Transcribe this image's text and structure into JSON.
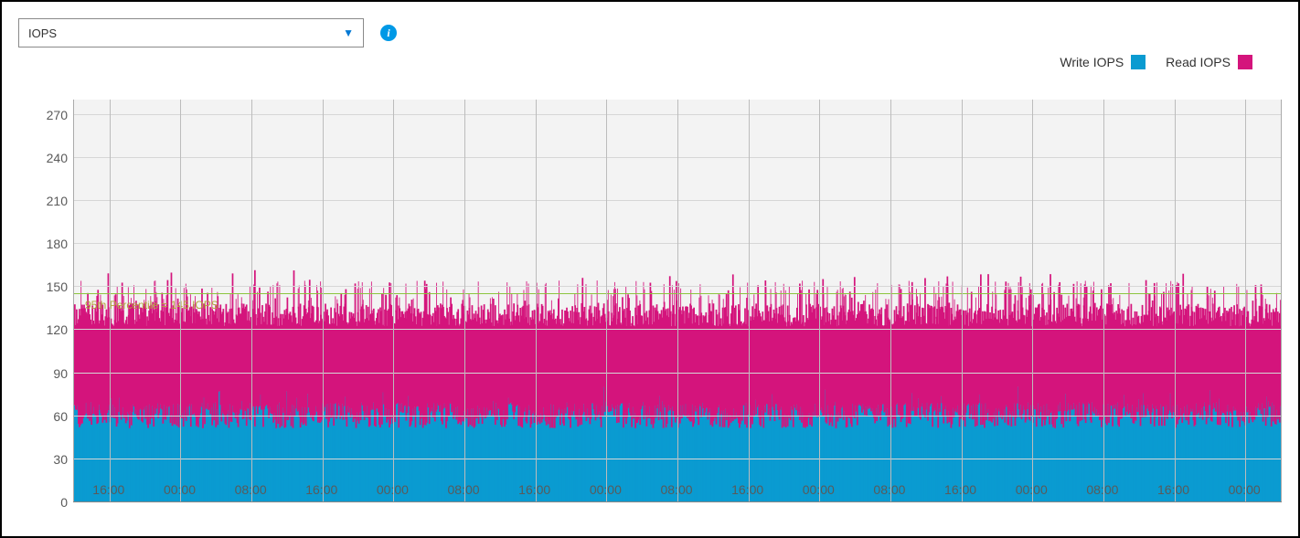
{
  "toolbar": {
    "metric_selected": "IOPS",
    "info_tooltip": "i"
  },
  "legend": {
    "items": [
      {
        "label": "Write IOPS",
        "color": "#0a9bd1"
      },
      {
        "label": "Read IOPS",
        "color": "#d4147c"
      }
    ]
  },
  "threshold": {
    "label": "95th Percentile = 145 IOPS",
    "value": 145
  },
  "chart_data": {
    "type": "area",
    "title": "IOPS",
    "xlabel": "",
    "ylabel": "",
    "ylim": [
      0,
      280
    ],
    "y_ticks": [
      0,
      30,
      60,
      90,
      120,
      150,
      180,
      210,
      240,
      270
    ],
    "x_ticks": [
      "16:00",
      "00:00",
      "08:00",
      "16:00",
      "00:00",
      "08:00",
      "16:00",
      "00:00",
      "08:00",
      "16:00",
      "00:00",
      "08:00",
      "16:00",
      "00:00",
      "08:00",
      "16:00",
      "00:00"
    ],
    "grid": true,
    "legend_position": "top-right",
    "threshold": {
      "label": "95th Percentile = 145 IOPS",
      "value": 145
    },
    "series": [
      {
        "name": "Write IOPS",
        "color": "#0a9bd1",
        "approx_mean": 60,
        "approx_peak": 75,
        "note": "dense high-frequency samples; area roughly 0–60 with spikes to ~75"
      },
      {
        "name": "Read IOPS",
        "color": "#d4147c",
        "approx_mean": 130,
        "approx_peak": 155,
        "note": "stacked above write; combined area ~60–135 with spikes to ~150"
      }
    ]
  }
}
